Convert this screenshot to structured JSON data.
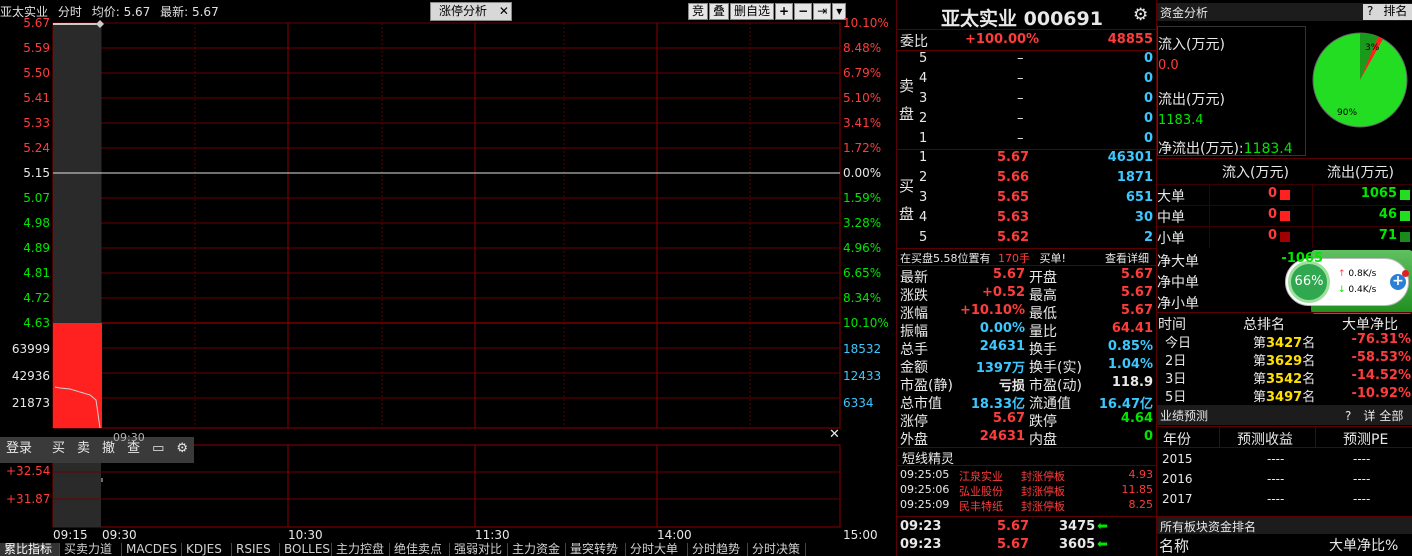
{
  "chart_header": {
    "name": "亚太实业",
    "period": "分时",
    "avg_label": "均价:",
    "avg": "5.67",
    "last_label": "最新:",
    "last": "5.67"
  },
  "tab_label": "涨停分析",
  "toolbar": [
    "竞",
    "叠",
    "删自选"
  ],
  "left_prices": [
    "5.67",
    "5.59",
    "5.50",
    "5.41",
    "5.33",
    "5.24",
    "5.15",
    "5.07",
    "4.98",
    "4.89",
    "4.81",
    "4.72",
    "4.63"
  ],
  "right_pcts": [
    "10.10%",
    "8.48%",
    "6.79%",
    "5.10%",
    "3.41%",
    "1.72%",
    "0.00%",
    "1.59%",
    "3.28%",
    "4.96%",
    "6.65%",
    "8.34%",
    "10.10%"
  ],
  "left_vol": [
    "63999",
    "42936",
    "21873"
  ],
  "right_vol": [
    "18532",
    "12433",
    "6334"
  ],
  "sub_left": [
    "+32.54",
    "+31.87"
  ],
  "time_labels": [
    "09:15",
    "09:30",
    "10:30",
    "11:30",
    "14:00",
    "15:00"
  ],
  "bottom_overlap": "09:30",
  "overlay_buttons": [
    "登录",
    "买",
    "卖",
    "撤",
    "查"
  ],
  "bottom_tabs": [
    "累比指标",
    "买卖力道",
    "MACDES",
    "KDJES",
    "RSIES",
    "BOLLES",
    "主力控盘",
    "绝佳卖点",
    "强弱对比",
    "主力资金",
    "量突转势",
    "分时大单",
    "分时趋势",
    "分时决策"
  ],
  "stock": {
    "name": "亚太实业",
    "code": "000691"
  },
  "wei": {
    "label": "委比",
    "pct": "+100.00%",
    "val": "48855"
  },
  "sell_label": "卖盘",
  "buy_label": "买盘",
  "sells": [
    {
      "lv": "5",
      "p": "–",
      "v": "0"
    },
    {
      "lv": "4",
      "p": "–",
      "v": "0"
    },
    {
      "lv": "3",
      "p": "–",
      "v": "0"
    },
    {
      "lv": "2",
      "p": "–",
      "v": "0"
    },
    {
      "lv": "1",
      "p": "–",
      "v": "0"
    }
  ],
  "buys": [
    {
      "lv": "1",
      "p": "5.67",
      "v": "46301"
    },
    {
      "lv": "2",
      "p": "5.66",
      "v": "1871"
    },
    {
      "lv": "3",
      "p": "5.65",
      "v": "651"
    },
    {
      "lv": "4",
      "p": "5.63",
      "v": "30"
    },
    {
      "lv": "5",
      "p": "5.62",
      "v": "2"
    }
  ],
  "note": {
    "a": "在买盘5.58位置有",
    "b": "170手",
    "c": "买单!",
    "d": "查看详细"
  },
  "quotes": [
    {
      "l1": "最新",
      "v1": "5.67",
      "c1": "red",
      "l2": "开盘",
      "v2": "5.67",
      "c2": "red"
    },
    {
      "l1": "涨跌",
      "v1": "+0.52",
      "c1": "red",
      "l2": "最高",
      "v2": "5.67",
      "c2": "red"
    },
    {
      "l1": "涨幅",
      "v1": "+10.10%",
      "c1": "red",
      "l2": "最低",
      "v2": "5.67",
      "c2": "red"
    },
    {
      "l1": "振幅",
      "v1": "0.00%",
      "c1": "cyn",
      "l2": "量比",
      "v2": "64.41",
      "c2": "red"
    },
    {
      "l1": "总手",
      "v1": "24631",
      "c1": "cyn",
      "l2": "换手",
      "v2": "0.85%",
      "c2": "cyn"
    },
    {
      "l1": "金额",
      "v1": "1397万",
      "c1": "cyn",
      "l2": "换手(实)",
      "v2": "1.04%",
      "c2": "cyn"
    },
    {
      "l1": "市盈(静)",
      "v1": "亏损",
      "c1": "wht",
      "l2": "市盈(动)",
      "v2": "118.9",
      "c2": "wht"
    },
    {
      "l1": "总市值",
      "v1": "18.33亿",
      "c1": "cyn",
      "l2": "流通值",
      "v2": "16.47亿",
      "c2": "cyn"
    },
    {
      "l1": "涨停",
      "v1": "5.67",
      "c1": "red",
      "l2": "跌停",
      "v2": "4.64",
      "c2": "grn"
    },
    {
      "l1": "外盘",
      "v1": "24631",
      "c1": "red",
      "l2": "内盘",
      "v2": "0",
      "c2": "grn"
    }
  ],
  "short": {
    "title": "短线精灵",
    "rows": [
      {
        "t": "09:25:05",
        "n": "江泉实业",
        "e": "封涨停板",
        "v": "4.93"
      },
      {
        "t": "09:25:06",
        "n": "弘业股份",
        "e": "封涨停板",
        "v": "11.85"
      },
      {
        "t": "09:25:09",
        "n": "民丰特纸",
        "e": "封涨停板",
        "v": "8.25"
      }
    ]
  },
  "ticks": [
    {
      "t": "09:23",
      "p": "5.67",
      "v": "3475"
    },
    {
      "t": "09:23",
      "p": "5.67",
      "v": "3605"
    }
  ],
  "fund": {
    "title": "资金分析",
    "q": "?",
    "rank": "排名",
    "in_label": "流入(万元)",
    "in_val": "0.0",
    "out_label": "流出(万元)",
    "out_val": "1183.4",
    "net_label": "净流出(万元):",
    "net_val": "1183.4",
    "pie": {
      "small_label": "3%",
      "big_label": "90%"
    },
    "head_in": "流入(万元)",
    "head_out": "流出(万元)",
    "rows": [
      {
        "l": "大单",
        "in": "0",
        "out": "1065"
      },
      {
        "l": "中单",
        "in": "0",
        "out": "46"
      },
      {
        "l": "小单",
        "in": "0",
        "out": "71"
      }
    ],
    "net_rows": [
      {
        "l": "净大单",
        "v": "-1065"
      },
      {
        "l": "净中单",
        "v": ""
      },
      {
        "l": "净小单",
        "v": ""
      }
    ]
  },
  "speed": {
    "pct": "66%",
    "up": "0.8K/s",
    "down": "0.4K/s"
  },
  "rank": {
    "h1": "时间",
    "h2": "总排名",
    "h3": "大单净比",
    "rows": [
      {
        "t": "今日",
        "pre": "第",
        "n": "3427",
        "suf": "名",
        "v": "-76.31%"
      },
      {
        "t": "2日",
        "pre": "第",
        "n": "3629",
        "suf": "名",
        "v": "-58.53%"
      },
      {
        "t": "3日",
        "pre": "第",
        "n": "3542",
        "suf": "名",
        "v": "-14.52%"
      },
      {
        "t": "5日",
        "pre": "第",
        "n": "3497",
        "suf": "名",
        "v": "-10.92%"
      }
    ]
  },
  "forecast": {
    "title": "业绩预测",
    "q": "?",
    "detail": "详",
    "all": "全部",
    "h1": "年份",
    "h2": "预测收益",
    "h3": "预测PE",
    "rows": [
      {
        "y": "2015",
        "a": "----",
        "b": "----"
      },
      {
        "y": "2016",
        "a": "----",
        "b": "----"
      },
      {
        "y": "2017",
        "a": "----",
        "b": "----"
      }
    ]
  },
  "sector": {
    "title": "所有板块资金排名",
    "h1": "名称",
    "h2": "大单净比%"
  },
  "colors": {
    "grid": "#7a0000",
    "red": "#ff3c3c",
    "green": "#00e600",
    "cyan": "#3cc8ff",
    "yellow": "#ffe000"
  }
}
